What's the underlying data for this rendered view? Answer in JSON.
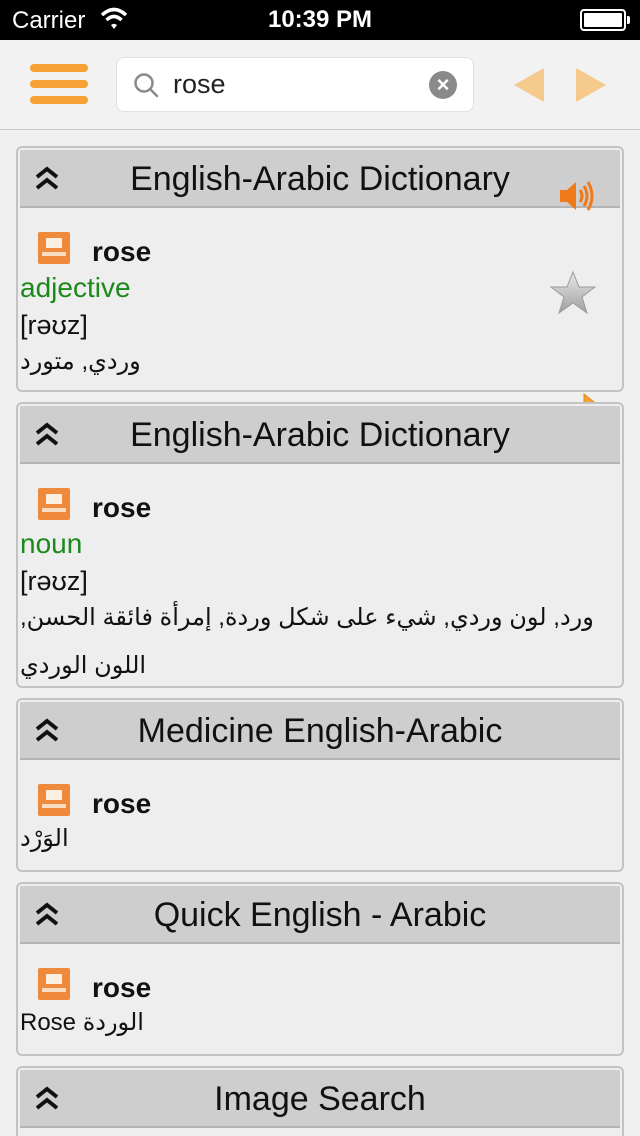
{
  "status": {
    "carrier": "Carrier",
    "time": "10:39 PM"
  },
  "search": {
    "query": "rose",
    "clear": "×"
  },
  "accent": "#f7a234",
  "cards": [
    {
      "title": "English-Arabic Dictionary",
      "word": "rose",
      "pos": "adjective",
      "pron": "[rəʊz]",
      "translation": "وردي, متورد"
    },
    {
      "title": "English-Arabic Dictionary",
      "word": "rose",
      "pos": "noun",
      "pron": "[rəʊz]",
      "translation": "ورد, لون وردي, شيء على شكل وردة, إمرأة فائقة الحسن, اللون الوردي"
    },
    {
      "title": "Medicine English-Arabic",
      "word": "rose",
      "translation": "الوَرْد"
    },
    {
      "title": "Quick English - Arabic",
      "word": "rose",
      "translation": "Rose الوردة"
    },
    {
      "title": "Image Search"
    }
  ]
}
